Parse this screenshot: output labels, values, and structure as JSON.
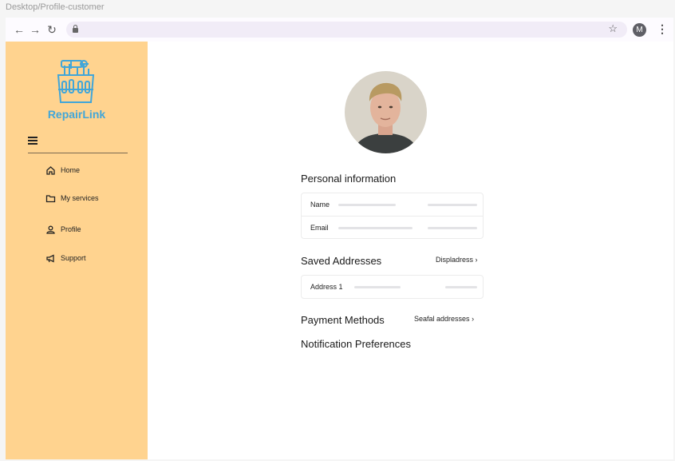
{
  "frame_label": "Desktop/Profile-customer",
  "browser": {
    "profile_initial": "M"
  },
  "brand": {
    "name": "RepairLink",
    "color": "#41a6d9"
  },
  "sidebar": {
    "background": "#ffd38f",
    "items": [
      {
        "label": "Home",
        "icon": "home-icon"
      },
      {
        "label": "My services",
        "icon": "folder-icon"
      },
      {
        "label": "Profile",
        "icon": "user-icon"
      },
      {
        "label": "Support",
        "icon": "megaphone-icon"
      }
    ]
  },
  "profile": {
    "personal_title": "Personal information",
    "fields": [
      {
        "label": "Name"
      },
      {
        "label": "Email"
      }
    ],
    "saved_title": "Saved Addresses",
    "saved_link": "Displadress",
    "address_label": "Address 1",
    "payment_title": "Payment Methods",
    "payment_link": "Seafal addresses",
    "notification_title": "Notification Preferences"
  }
}
